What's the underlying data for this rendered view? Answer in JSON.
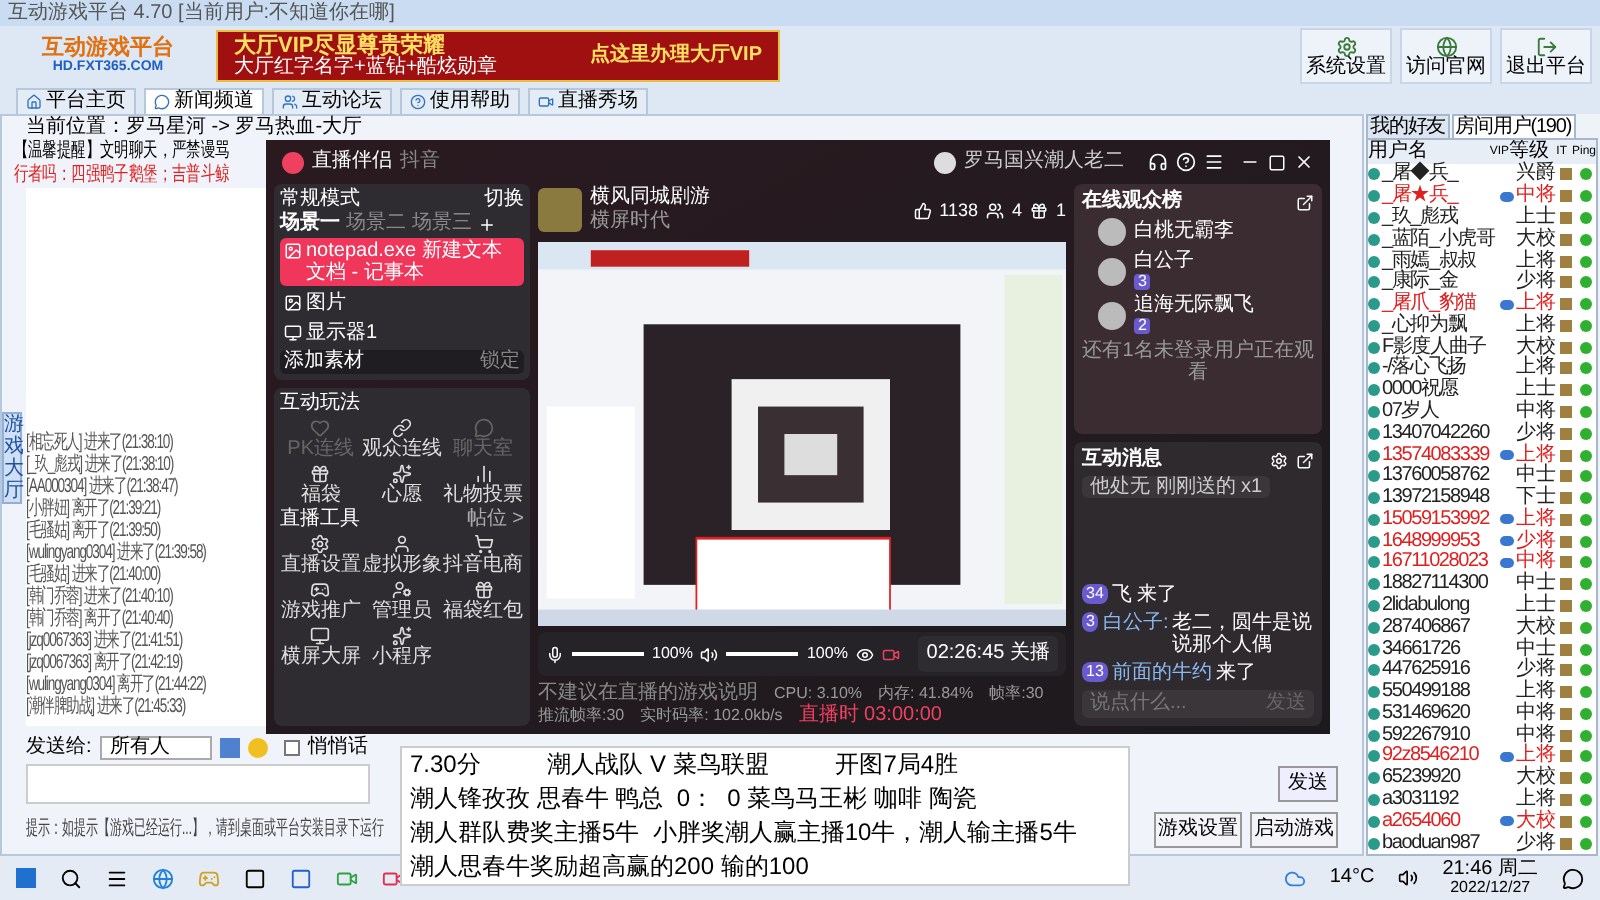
{
  "window": {
    "title": "互动游戏平台 4.70 [当前用户:不知道你在哪]"
  },
  "header": {
    "logo_title": "互动游戏平台",
    "logo_url": "HD.FXT365.COM",
    "banner_title": "大厅VIP尽显尊贵荣耀",
    "banner_sub": "大厅红字名字+蓝钻+酷炫勋章",
    "banner_link": "点这里办理大厅VIP",
    "buttons": [
      "系统设置",
      "访问官网",
      "退出平台"
    ]
  },
  "tabs": [
    {
      "label": "平台主页",
      "selected": false
    },
    {
      "label": "新闻频道",
      "selected": true
    },
    {
      "label": "互动论坛",
      "selected": false
    },
    {
      "label": "使用帮助",
      "selected": false
    },
    {
      "label": "直播秀场",
      "selected": false
    }
  ],
  "hall": {
    "breadcrumb": "当前位置：罗马星河 -> 罗马热血-大厅",
    "notice": "【温馨提醒】文明聊天，严禁谩骂",
    "notice2": "行者吗：四强鸭子鹅堡；吉普斗鲸",
    "side_tab": "游戏大厅",
    "log": [
      "[相忘死人] 进来了(21:38:10)",
      "[_玖_彪戎] 进来了(21:38:10)",
      "[AA000304] 进来了(21:38:47)",
      "[小胖妞] 离开了(21:39:21)",
      "[毛骚姑] 离开了(21:39:50)",
      "[wulingyang0304] 进来了(21:39:58)",
      "[毛骚姑] 进来了(21:40:00)",
      "[韩门乔蓉] 进来了(21:40:10)",
      "[韩门乔蓉] 离开了(21:40:40)",
      "[jzq0067363] 进来了(21:41:51)",
      "[jzq0067363] 离开了(21:42:19)",
      "[wulingyang0304] 离开了(21:44:22)",
      "[潮伴脾助战] 进来了(21:45:33)"
    ],
    "send_label": "发送给:",
    "send_to": "所有人",
    "whisper": {
      "label": "悄悄话",
      "checked": false
    },
    "send_button": "发送",
    "hint": "提示：如提示【游戏已经运行...】，请到桌面或平台安装目录下运行",
    "game_buttons": [
      "游戏设置",
      "启动游戏"
    ]
  },
  "users": {
    "tabs": [
      {
        "label": "我的好友",
        "selected": false
      },
      {
        "label": "房间用户(190)",
        "selected": true
      }
    ],
    "columns": [
      "用户名",
      "VIP",
      "等级",
      "IT",
      "Ping"
    ],
    "rows": [
      {
        "name": "_屠◆兵_",
        "level": "兴爵",
        "vip": false
      },
      {
        "name": "_屠★兵_",
        "level": "中将",
        "vip": true
      },
      {
        "name": "_玖_彪戎",
        "level": "上士",
        "vip": false
      },
      {
        "name": "_蓝陌_小虎哥",
        "level": "大校",
        "vip": false
      },
      {
        "name": "_雨嫣_叔叔",
        "level": "上将",
        "vip": false
      },
      {
        "name": "_康际_金",
        "level": "少将",
        "vip": false
      },
      {
        "name": "_屠爪_豹猫",
        "level": "上将",
        "vip": true
      },
      {
        "name": "_心抑为飘",
        "level": "上将",
        "vip": false
      },
      {
        "name": "F影度人曲子",
        "level": "大校",
        "vip": false
      },
      {
        "name": "-/落心飞扬",
        "level": "上将",
        "vip": false
      },
      {
        "name": "0000祝愿",
        "level": "上士",
        "vip": false
      },
      {
        "name": "07岁人",
        "level": "中将",
        "vip": false
      },
      {
        "name": "13407042260",
        "level": "少将",
        "vip": false
      },
      {
        "name": "13574083339",
        "level": "上将",
        "vip": true
      },
      {
        "name": "13760058762",
        "level": "中士",
        "vip": false
      },
      {
        "name": "13972158948",
        "level": "下士",
        "vip": false
      },
      {
        "name": "15059153992",
        "level": "上将",
        "vip": true
      },
      {
        "name": "1648999953",
        "level": "少将",
        "vip": true
      },
      {
        "name": "16711028023",
        "level": "中将",
        "vip": true
      },
      {
        "name": "18827114300",
        "level": "中士",
        "vip": false
      },
      {
        "name": "2lidabulong",
        "level": "上士",
        "vip": false
      },
      {
        "name": "287406867",
        "level": "大校",
        "vip": false
      },
      {
        "name": "34661726",
        "level": "中士",
        "vip": false
      },
      {
        "name": "447625916",
        "level": "少将",
        "vip": false
      },
      {
        "name": "550499188",
        "level": "上将",
        "vip": false
      },
      {
        "name": "531469620",
        "level": "中将",
        "vip": false
      },
      {
        "name": "592267910",
        "level": "中将",
        "vip": false
      },
      {
        "name": "92z8546210",
        "level": "上将",
        "vip": true
      },
      {
        "name": "65239920",
        "level": "大校",
        "vip": false
      },
      {
        "name": "a3031192",
        "level": "上将",
        "vip": false
      },
      {
        "name": "a2654060",
        "level": "大校",
        "vip": true
      },
      {
        "name": "baoduan987",
        "level": "少将",
        "vip": false
      }
    ]
  },
  "stream": {
    "app": "直播伴侣",
    "platform": "抖音",
    "account": "罗马国兴潮人老二",
    "mode": "常规模式",
    "switch": "切换",
    "scenes": [
      {
        "label": "场景一",
        "selected": true
      },
      {
        "label": "场景二",
        "selected": false
      },
      {
        "label": "场景三",
        "selected": false
      }
    ],
    "sources": [
      {
        "label": "notepad.exe 新建文本文档 - 记事本",
        "selected": true
      },
      {
        "label": "图片",
        "selected": false
      },
      {
        "label": "显示器1",
        "selected": false
      }
    ],
    "add_source": "添加素材",
    "lock": "锁定",
    "play_title": "互动玩法",
    "play": [
      {
        "label": "PK连线",
        "disabled": true
      },
      {
        "label": "观众连线",
        "disabled": false
      },
      {
        "label": "聊天室",
        "disabled": true
      },
      {
        "label": "福袋",
        "disabled": false
      },
      {
        "label": "心愿",
        "disabled": false
      },
      {
        "label": "礼物投票",
        "disabled": false
      }
    ],
    "tools_title": "直播工具",
    "tools_more": "帖位 >",
    "tools": [
      "直播设置",
      "虚拟形象",
      "抖音电商",
      "游戏推广",
      "管理员",
      "福袋红包",
      "横屏大屏",
      "小程序"
    ],
    "room_title": "横风同城剧游",
    "room_sub": "横屏时代",
    "likes": "1138",
    "viewers": "4",
    "gifts": "1",
    "mic": {
      "level": 1,
      "reading": "100%"
    },
    "speaker": {
      "level": 1,
      "reading": "100%"
    },
    "timer": "02:26:45 关播",
    "footer_note": "不建议在直播的游戏说明",
    "stats": [
      "CPU: 3.10%",
      "内存: 41.84%",
      "帧率:30",
      "推流帧率:30",
      "实时码率: 102.0kb/s"
    ],
    "live_time": "直播时 03:00:00",
    "rank_title": "在线观众榜",
    "audience": [
      {
        "name": "白桃无霸李"
      },
      {
        "name": "白公子",
        "badge": "3"
      },
      {
        "name": "追海无际飘飞",
        "badge": "2"
      }
    ],
    "audience_note": "还有1名未登录用户正在观看",
    "msg_title": "互动消息",
    "gift_msg": "他处无 刚刚送的 x1",
    "messages": [
      {
        "badge": "34",
        "text": "飞 来了"
      },
      {
        "badge": "3",
        "user": "白公子:",
        "text": "老二，圆牛是说说那个人偶"
      },
      {
        "badge": "13",
        "user": "前面的牛约",
        "text": "来了"
      }
    ],
    "msg_placeholder": "说点什么...",
    "msg_send": "发送"
  },
  "notepad": {
    "lines": [
      "7.30分          潮人战队 V 菜鸟联盟          开图7局4胜",
      "潮人锋孜孜 思春牛 鸭总  0：  0 菜鸟马王彬 咖啡 陶瓷",
      "潮人群队费奖主播5牛  小胖奖潮人赢主播10牛，潮人输主播5牛",
      "潮人思春牛奖励超高赢的200 输的100"
    ]
  },
  "taskbar": {
    "weather": "14°C",
    "time": "21:46 周二",
    "date": "2022/12/27"
  }
}
